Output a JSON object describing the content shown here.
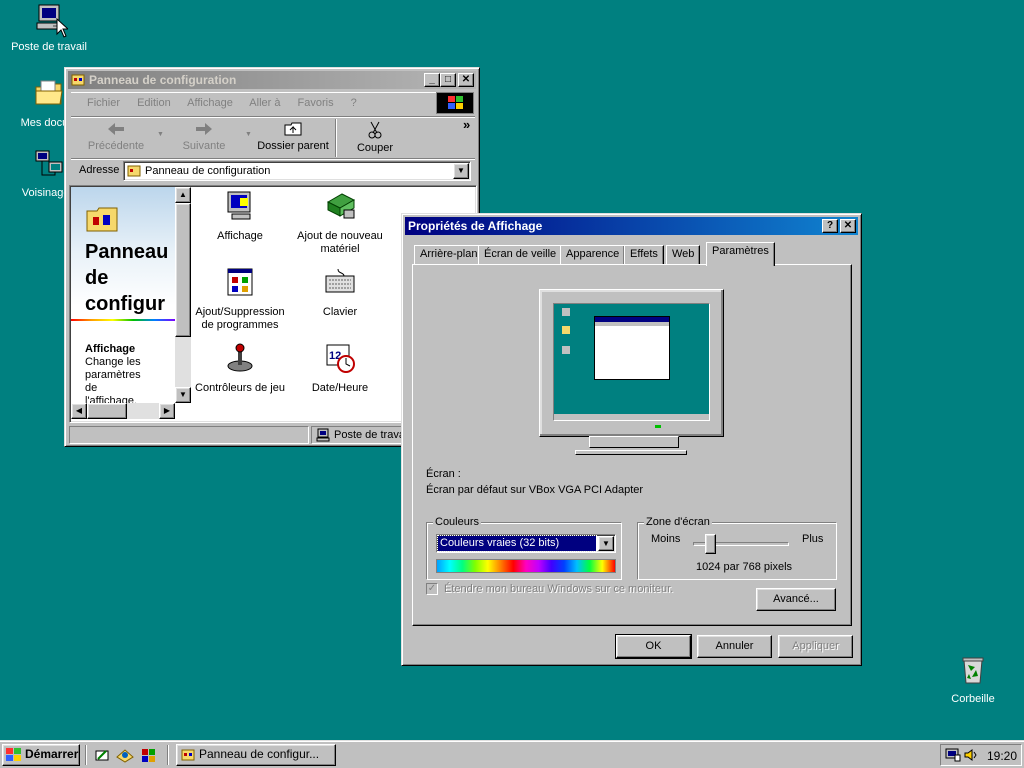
{
  "desktop": {
    "icons": [
      {
        "label": "Poste de travail"
      },
      {
        "label": "Mes docum"
      },
      {
        "label": "Voisinage r"
      },
      {
        "label": "Corbeille"
      }
    ]
  },
  "control_panel": {
    "title": "Panneau de configuration",
    "menu": [
      "Fichier",
      "Edition",
      "Affichage",
      "Aller à",
      "Favoris",
      "?"
    ],
    "toolbar": {
      "back": "Précédente",
      "forward": "Suivante",
      "up": "Dossier parent",
      "cut": "Couper",
      "more": "»"
    },
    "address_label": "Adresse",
    "address_value": "Panneau de configuration",
    "side_title": "Panneau de configur",
    "side_title_lines": [
      "Panneau",
      "de",
      "configur"
    ],
    "side_item_title": "Affichage",
    "side_item_desc": [
      "Change les",
      "paramètres",
      "de",
      "l'affichage."
    ],
    "items": [
      {
        "label": "Affichage",
        "icon": "display-icon"
      },
      {
        "label": "Ajout de nouveau matériel",
        "icon": "hardware-icon"
      },
      {
        "label": "Ajout/Suppression de programmes",
        "icon": "programs-icon"
      },
      {
        "label": "Clavier",
        "icon": "keyboard-icon"
      },
      {
        "label": "Contrôleurs de jeu",
        "icon": "joystick-icon"
      },
      {
        "label": "Date/Heure",
        "icon": "clock-icon"
      }
    ],
    "status_right": "Poste de trava"
  },
  "display_props": {
    "title": "Propriétés de Affichage",
    "help": "?",
    "close": "✕",
    "tabs": [
      "Arrière-plan",
      "Écran de veille",
      "Apparence",
      "Effets",
      "Web",
      "Paramètres"
    ],
    "screen_label": "Écran :",
    "screen_value": "Écran par défaut sur VBox VGA PCI Adapter",
    "colors_group": "Couleurs",
    "colors_value": "Couleurs vraies (32 bits)",
    "area_group": "Zone d'écran",
    "less": "Moins",
    "more": "Plus",
    "resolution": "1024 par 768 pixels",
    "extend_checkbox": "Étendre mon bureau Windows sur ce moniteur.",
    "advanced": "Avancé...",
    "ok": "OK",
    "cancel": "Annuler",
    "apply": "Appliquer"
  },
  "taskbar": {
    "start": "Démarrer",
    "task": "Panneau de configur...",
    "clock": "19:20"
  }
}
